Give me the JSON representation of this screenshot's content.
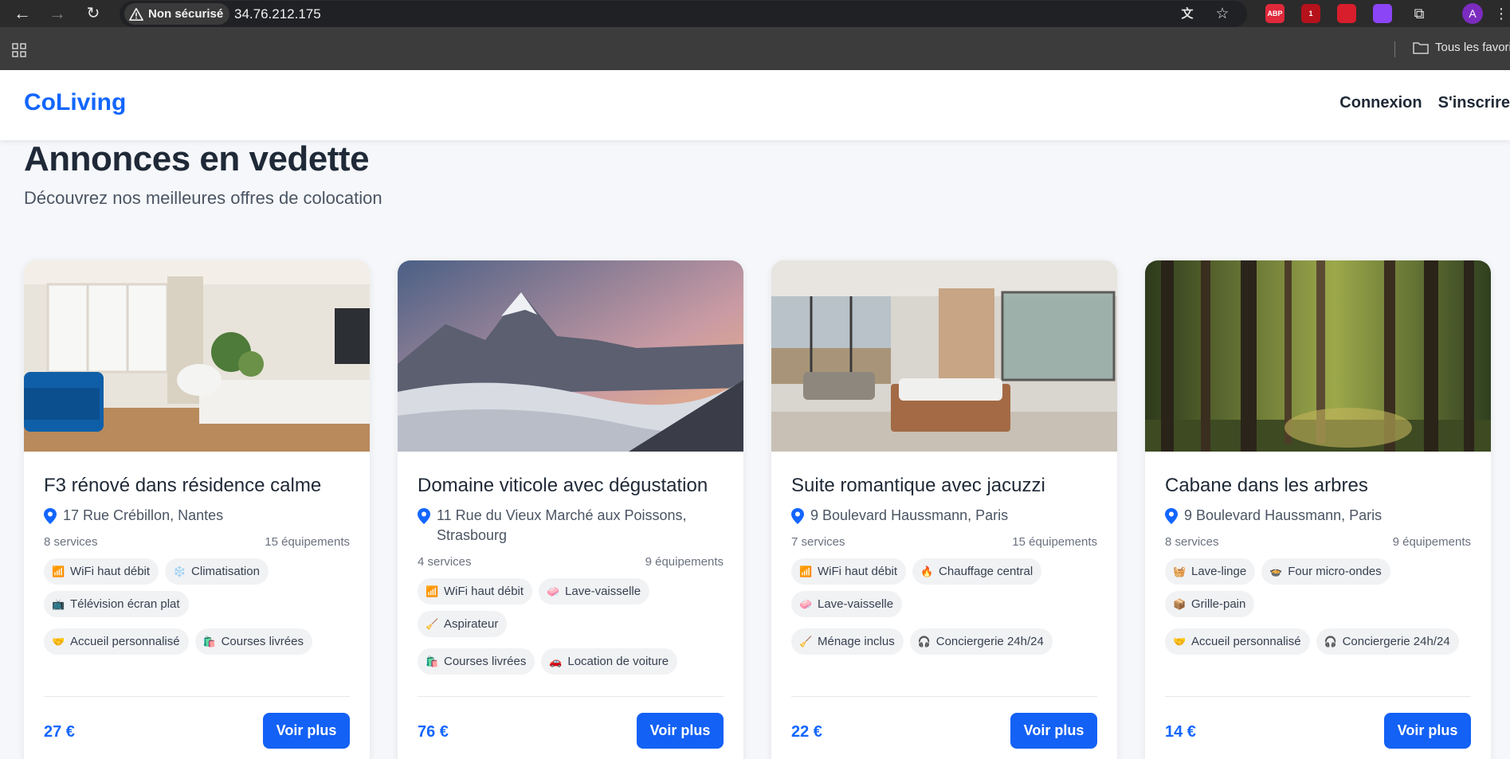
{
  "browser": {
    "security_label": "Non sécurisé",
    "url": "34.76.212.175",
    "bookmarks_folder": "Tous les favoris",
    "profile_initial": "A",
    "extensions": [
      {
        "name": "adblock-plus-icon",
        "label": "ABP",
        "color": "#e0293b"
      },
      {
        "name": "extension-badge-icon",
        "label": "1",
        "color": "#b5121b"
      },
      {
        "name": "extension-red-icon",
        "label": "",
        "color": "#d81e2c"
      },
      {
        "name": "twitch-icon",
        "label": "",
        "color": "#8c44f7"
      }
    ]
  },
  "header": {
    "brand": "CoLiving",
    "login": "Connexion",
    "signup": "S'inscrire"
  },
  "hero": {
    "title": "Annonces en vedette",
    "subtitle": "Découvrez nos meilleures offres de colocation"
  },
  "colors": {
    "accent": "#1366ff",
    "button": "#1361f5"
  },
  "listings": [
    {
      "image": "living-room-photo",
      "title": "F3 rénové dans résidence calme",
      "address": "17 Rue Crébillon, Nantes",
      "services": "8 services",
      "equipments": "15 équipements",
      "tags_a": [
        {
          "icon": "📶",
          "label": "WiFi haut débit"
        },
        {
          "icon": "❄️",
          "label": "Climatisation"
        },
        {
          "icon": "📺",
          "label": "Télévision écran plat"
        }
      ],
      "tags_b": [
        {
          "icon": "🤝",
          "label": "Accueil personnalisé"
        },
        {
          "icon": "🛍️",
          "label": "Courses livrées"
        }
      ],
      "price": "27 €",
      "button": "Voir plus"
    },
    {
      "image": "mountain-photo",
      "title": "Domaine viticole avec dégustation",
      "address": "11 Rue du Vieux Marché aux Poissons, Strasbourg",
      "services": "4 services",
      "equipments": "9 équipements",
      "tags_a": [
        {
          "icon": "📶",
          "label": "WiFi haut débit"
        },
        {
          "icon": "🧼",
          "label": "Lave-vaisselle"
        },
        {
          "icon": "🧹",
          "label": "Aspirateur"
        }
      ],
      "tags_b": [
        {
          "icon": "🛍️",
          "label": "Courses livrées"
        },
        {
          "icon": "🚗",
          "label": "Location de voiture"
        }
      ],
      "price": "76 €",
      "button": "Voir plus"
    },
    {
      "image": "bedroom-photo",
      "title": "Suite romantique avec jacuzzi",
      "address": "9 Boulevard Haussmann, Paris",
      "services": "7 services",
      "equipments": "15 équipements",
      "tags_a": [
        {
          "icon": "📶",
          "label": "WiFi haut débit"
        },
        {
          "icon": "🔥",
          "label": "Chauffage central"
        },
        {
          "icon": "🧼",
          "label": "Lave-vaisselle"
        }
      ],
      "tags_b": [
        {
          "icon": "🧹",
          "label": "Ménage inclus"
        },
        {
          "icon": "🎧",
          "label": "Conciergerie 24h/24"
        }
      ],
      "price": "22 €",
      "button": "Voir plus"
    },
    {
      "image": "forest-photo",
      "title": "Cabane dans les arbres",
      "address": "9 Boulevard Haussmann, Paris",
      "services": "8 services",
      "equipments": "9 équipements",
      "tags_a": [
        {
          "icon": "🧺",
          "label": "Lave-linge"
        },
        {
          "icon": "🍲",
          "label": "Four micro-ondes"
        },
        {
          "icon": "📦",
          "label": "Grille-pain"
        }
      ],
      "tags_b": [
        {
          "icon": "🤝",
          "label": "Accueil personnalisé"
        },
        {
          "icon": "🎧",
          "label": "Conciergerie 24h/24"
        }
      ],
      "price": "14 €",
      "button": "Voir plus"
    }
  ]
}
